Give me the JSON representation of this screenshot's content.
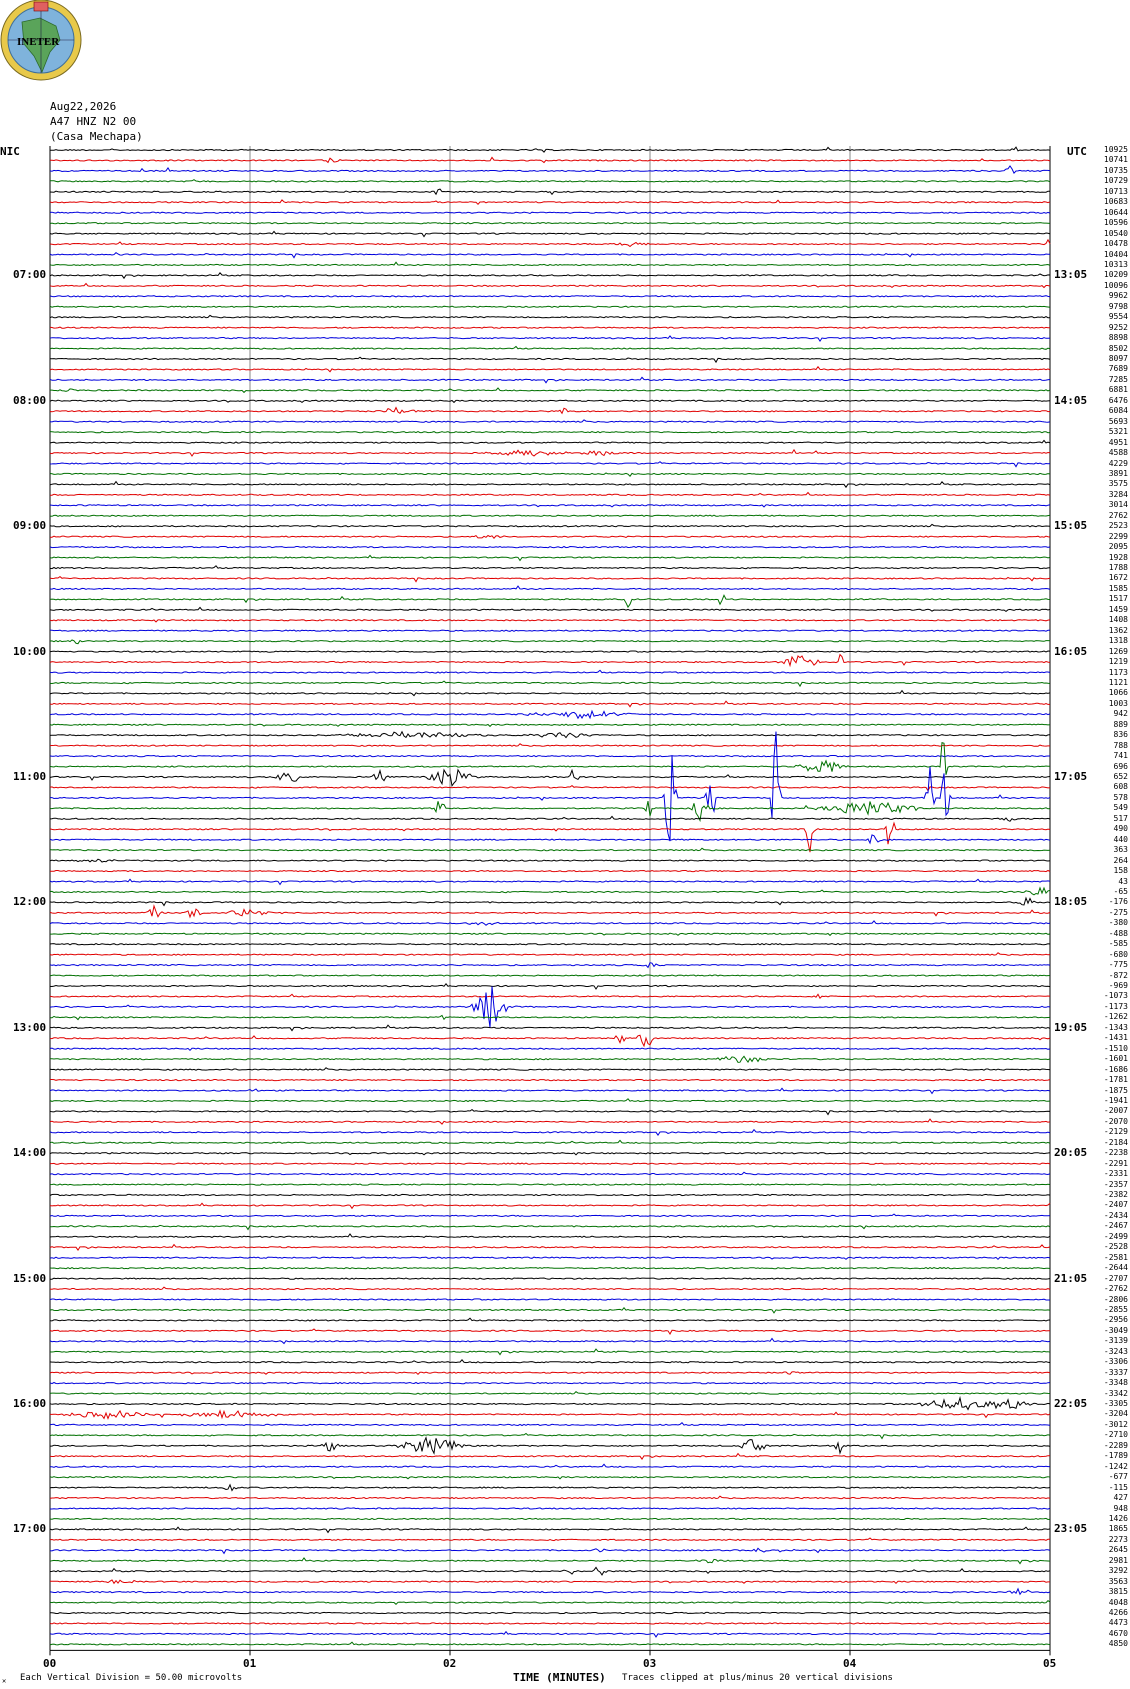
{
  "logo": {
    "text": "INETER"
  },
  "header": {
    "date": "Aug22,2026",
    "station": "A47 HNZ N2 00",
    "site": "(Casa Mechapa)"
  },
  "left_axis": {
    "label": "NIC",
    "times": [
      "07:00",
      "08:00",
      "09:00",
      "10:00",
      "11:00",
      "12:00",
      "13:00",
      "14:00",
      "15:00",
      "16:00",
      "17:00"
    ]
  },
  "right_axis": {
    "label": "UTC",
    "times": [
      "13:05",
      "14:05",
      "15:05",
      "16:05",
      "17:05",
      "18:05",
      "19:05",
      "20:05",
      "21:05",
      "22:05",
      "23:05"
    ]
  },
  "footer": {
    "left_text": "Each Vertical Division =    50.00 microvolts",
    "x_axis_label": "TIME (MINUTES)",
    "right_text": "Traces clipped at plus/minus 20 vertical divisions"
  },
  "colors": {
    "black": "#000000",
    "red": "#e00000",
    "blue": "#0000dd",
    "green": "#007000",
    "grid": "#888888"
  },
  "chart_data": {
    "type": "line",
    "title": "",
    "xlabel": "TIME (MINUTES)",
    "x_ticks": [
      "00",
      "01",
      "02",
      "03",
      "04",
      "05"
    ],
    "xlim": [
      0,
      5
    ],
    "start_time_nic": "06:00",
    "trace_minutes": 5,
    "traces_per_hour": 12,
    "trace_count": 144,
    "color_cycle": [
      "black",
      "red",
      "blue",
      "green"
    ],
    "offsets": [
      "10925",
      "10741",
      "10735",
      "10729",
      "10713",
      "10683",
      "10644",
      "10596",
      "10540",
      "10478",
      "10404",
      "10313",
      "10209",
      "10096",
      "9962",
      "9798",
      "9554",
      "9252",
      "8898",
      "8502",
      "8097",
      "7689",
      "7285",
      "6881",
      "6476",
      "6084",
      "5693",
      "5321",
      "4951",
      "4588",
      "4229",
      "3891",
      "3575",
      "3284",
      "3014",
      "2762",
      "2523",
      "2299",
      "2095",
      "1928",
      "1788",
      "1672",
      "1585",
      "1517",
      "1459",
      "1408",
      "1362",
      "1318",
      "1269",
      "1219",
      "1173",
      "1121",
      "1066",
      "1003",
      "942",
      "889",
      "836",
      "788",
      "741",
      "696",
      "652",
      "608",
      "578",
      "549",
      "517",
      "490",
      "440",
      "363",
      "264",
      "158",
      "43",
      "-65",
      "-176",
      "-275",
      "-380",
      "-488",
      "-585",
      "-680",
      "-775",
      "-872",
      "-969",
      "-1073",
      "-1173",
      "-1262",
      "-1343",
      "-1431",
      "-1510",
      "-1601",
      "-1686",
      "-1781",
      "-1875",
      "-1941",
      "-2007",
      "-2070",
      "-2129",
      "-2184",
      "-2238",
      "-2291",
      "-2331",
      "-2357",
      "-2382",
      "-2407",
      "-2434",
      "-2467",
      "-2499",
      "-2528",
      "-2581",
      "-2644",
      "-2707",
      "-2762",
      "-2806",
      "-2855",
      "-2956",
      "-3049",
      "-3139",
      "-3243",
      "-3306",
      "-3337",
      "-3348",
      "-3342",
      "-3305",
      "-3204",
      "-3012",
      "-2710",
      "-2289",
      "-1789",
      "-1242",
      "-677",
      "-115",
      "427",
      "948",
      "1426",
      "1865",
      "2273",
      "2645",
      "2981",
      "3292",
      "3563",
      "3815",
      "4048",
      "4266",
      "4473",
      "4670",
      "4850"
    ],
    "events": [
      {
        "trace": 0,
        "minute": 4.82,
        "amp": 3,
        "width": 0.03
      },
      {
        "trace": 1,
        "minute": 1.4,
        "amp": 4,
        "width": 0.06
      },
      {
        "trace": 2,
        "minute": 4.8,
        "amp": 6,
        "width": 0.03
      },
      {
        "trace": 4,
        "minute": 1.94,
        "amp": 4,
        "width": 0.02
      },
      {
        "trace": 9,
        "minute": 2.9,
        "amp": 3,
        "width": 0.12
      },
      {
        "trace": 9,
        "minute": 5.0,
        "amp": 8,
        "width": 0.02
      },
      {
        "trace": 23,
        "minute": 0.11,
        "amp": 3,
        "width": 0.05
      },
      {
        "trace": 25,
        "minute": 1.73,
        "amp": 4,
        "width": 0.15
      },
      {
        "trace": 25,
        "minute": 2.57,
        "amp": 4,
        "width": 0.03
      },
      {
        "trace": 29,
        "minute": 2.4,
        "amp": 4,
        "width": 0.25
      },
      {
        "trace": 29,
        "minute": 2.75,
        "amp": 4,
        "width": 0.12
      },
      {
        "trace": 37,
        "minute": 2.2,
        "amp": 3,
        "width": 0.1
      },
      {
        "trace": 43,
        "minute": 2.89,
        "amp": 10,
        "width": 0.02
      },
      {
        "trace": 43,
        "minute": 3.36,
        "amp": 16,
        "width": 0.02
      },
      {
        "trace": 47,
        "minute": 0.13,
        "amp": 4,
        "width": 0.03
      },
      {
        "trace": 49,
        "minute": 3.75,
        "amp": 10,
        "width": 0.12
      },
      {
        "trace": 49,
        "minute": 3.95,
        "amp": 12,
        "width": 0.02
      },
      {
        "trace": 54,
        "minute": 2.65,
        "amp": 5,
        "width": 0.3
      },
      {
        "trace": 56,
        "minute": 1.8,
        "amp": 4,
        "width": 0.5
      },
      {
        "trace": 56,
        "minute": 2.55,
        "amp": 4,
        "width": 0.2
      },
      {
        "trace": 59,
        "minute": 3.85,
        "amp": 10,
        "width": 0.15
      },
      {
        "trace": 59,
        "minute": 4.47,
        "amp": 40,
        "width": 0.02
      },
      {
        "trace": 60,
        "minute": 1.2,
        "amp": 10,
        "width": 0.08
      },
      {
        "trace": 60,
        "minute": 1.65,
        "amp": 8,
        "width": 0.05
      },
      {
        "trace": 60,
        "minute": 2.0,
        "amp": 12,
        "width": 0.15
      },
      {
        "trace": 60,
        "minute": 2.62,
        "amp": 10,
        "width": 0.03
      },
      {
        "trace": 62,
        "minute": 3.1,
        "amp": 80,
        "width": 0.04
      },
      {
        "trace": 62,
        "minute": 3.3,
        "amp": 40,
        "width": 0.03
      },
      {
        "trace": 62,
        "minute": 3.63,
        "amp": 60,
        "width": 0.03
      },
      {
        "trace": 62,
        "minute": 4.48,
        "amp": 40,
        "width": 0.03
      },
      {
        "trace": 62,
        "minute": 4.4,
        "amp": 30,
        "width": 0.03
      },
      {
        "trace": 63,
        "minute": 1.95,
        "amp": 10,
        "width": 0.03
      },
      {
        "trace": 63,
        "minute": 3.0,
        "amp": 10,
        "width": 0.03
      },
      {
        "trace": 63,
        "minute": 3.25,
        "amp": 15,
        "width": 0.05
      },
      {
        "trace": 63,
        "minute": 4.1,
        "amp": 10,
        "width": 0.3
      },
      {
        "trace": 64,
        "minute": 4.8,
        "amp": 4,
        "width": 0.05
      },
      {
        "trace": 65,
        "minute": 3.8,
        "amp": 20,
        "width": 0.03
      },
      {
        "trace": 65,
        "minute": 4.2,
        "amp": 20,
        "width": 0.03
      },
      {
        "trace": 66,
        "minute": 4.12,
        "amp": 8,
        "width": 0.05
      },
      {
        "trace": 68,
        "minute": 0.25,
        "amp": 3,
        "width": 0.15
      },
      {
        "trace": 71,
        "minute": 4.95,
        "amp": 8,
        "width": 0.08
      },
      {
        "trace": 72,
        "minute": 4.88,
        "amp": 8,
        "width": 0.05
      },
      {
        "trace": 73,
        "minute": 0.52,
        "amp": 10,
        "width": 0.05
      },
      {
        "trace": 73,
        "minute": 0.72,
        "amp": 10,
        "width": 0.05
      },
      {
        "trace": 73,
        "minute": 1.0,
        "amp": 5,
        "width": 0.15
      },
      {
        "trace": 74,
        "minute": 2.15,
        "amp": 3,
        "width": 0.12
      },
      {
        "trace": 78,
        "minute": 3.0,
        "amp": 4,
        "width": 0.05
      },
      {
        "trace": 81,
        "minute": 3.85,
        "amp": 3,
        "width": 0.05
      },
      {
        "trace": 82,
        "minute": 2.2,
        "amp": 30,
        "width": 0.1
      },
      {
        "trace": 83,
        "minute": 1.96,
        "amp": 4,
        "width": 0.02
      },
      {
        "trace": 85,
        "minute": 2.98,
        "amp": 15,
        "width": 0.05
      },
      {
        "trace": 85,
        "minute": 2.85,
        "amp": 5,
        "width": 0.05
      },
      {
        "trace": 87,
        "minute": 3.45,
        "amp": 6,
        "width": 0.15
      },
      {
        "trace": 90,
        "minute": 1.02,
        "amp": 3,
        "width": 0.03
      },
      {
        "trace": 117,
        "minute": 3.7,
        "amp": 3,
        "width": 0.05
      },
      {
        "trace": 120,
        "minute": 4.55,
        "amp": 8,
        "width": 0.25
      },
      {
        "trace": 120,
        "minute": 4.8,
        "amp": 8,
        "width": 0.15
      },
      {
        "trace": 121,
        "minute": 0.3,
        "amp": 5,
        "width": 0.3
      },
      {
        "trace": 121,
        "minute": 0.9,
        "amp": 5,
        "width": 0.3
      },
      {
        "trace": 124,
        "minute": 1.4,
        "amp": 8,
        "width": 0.06
      },
      {
        "trace": 124,
        "minute": 1.9,
        "amp": 12,
        "width": 0.2
      },
      {
        "trace": 124,
        "minute": 3.52,
        "amp": 10,
        "width": 0.08
      },
      {
        "trace": 124,
        "minute": 3.95,
        "amp": 8,
        "width": 0.03
      },
      {
        "trace": 128,
        "minute": 0.9,
        "amp": 6,
        "width": 0.04
      },
      {
        "trace": 134,
        "minute": 2.75,
        "amp": 4,
        "width": 0.05
      },
      {
        "trace": 134,
        "minute": 3.55,
        "amp": 4,
        "width": 0.05
      },
      {
        "trace": 135,
        "minute": 3.3,
        "amp": 3,
        "width": 0.08
      },
      {
        "trace": 136,
        "minute": 2.75,
        "amp": 8,
        "width": 0.05
      },
      {
        "trace": 136,
        "minute": 2.6,
        "amp": 4,
        "width": 0.05
      },
      {
        "trace": 137,
        "minute": 0.35,
        "amp": 3,
        "width": 0.1
      },
      {
        "trace": 138,
        "minute": 4.85,
        "amp": 5,
        "width": 0.08
      }
    ]
  }
}
